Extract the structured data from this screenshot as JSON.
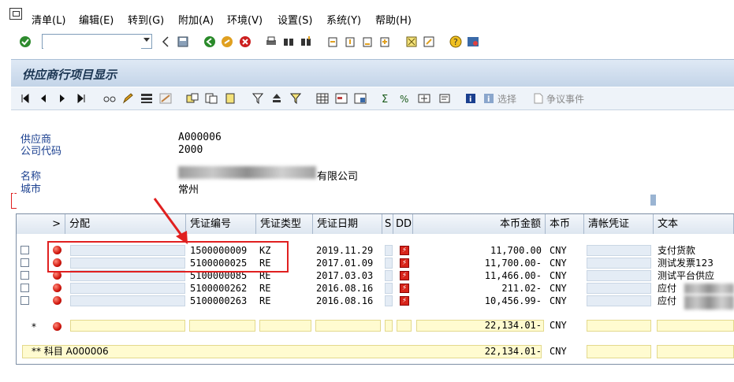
{
  "menu": [
    "清单(L)",
    "编辑(E)",
    "转到(G)",
    "附加(A)",
    "环境(V)",
    "设置(S)",
    "系统(Y)",
    "帮助(H)"
  ],
  "command_field": {
    "value": "",
    "placeholder": ""
  },
  "title": "供应商行项目显示",
  "app_toolbar": {
    "select_label": "选择",
    "dispute_label": "争议事件"
  },
  "header": {
    "vendor_label": "供应商",
    "vendor_value": "A000006",
    "company_label": "公司代码",
    "company_value": "2000",
    "name_label": "名称",
    "name_value": "有限公司",
    "city_label": "城市",
    "city_value": "常州"
  },
  "columns": [
    ">",
    "分配",
    "凭证编号",
    "凭证类型",
    "凭证日期",
    "S",
    "DD",
    "本币金额",
    "本币",
    "清帐凭证",
    "文本"
  ],
  "rows": [
    {
      "doc_no": "1500000009",
      "doc_type": "KZ",
      "date": "2019.11.29",
      "amount": "11,700.00",
      "currency": "CNY",
      "text": "支付货款"
    },
    {
      "doc_no": "5100000025",
      "doc_type": "RE",
      "date": "2017.01.09",
      "amount": "11,700.00-",
      "currency": "CNY",
      "text": "测试发票123"
    },
    {
      "doc_no": "5100000085",
      "doc_type": "RE",
      "date": "2017.03.03",
      "amount": "11,466.00-",
      "currency": "CNY",
      "text": "测试平台供应"
    },
    {
      "doc_no": "5100000262",
      "doc_type": "RE",
      "date": "2016.08.16",
      "amount": "211.02-",
      "currency": "CNY",
      "text": "应付"
    },
    {
      "doc_no": "5100000263",
      "doc_type": "RE",
      "date": "2016.08.16",
      "amount": "10,456.99-",
      "currency": "CNY",
      "text": "应付"
    }
  ],
  "subtotal": {
    "marker": "*",
    "amount": "22,134.01-",
    "currency": "CNY"
  },
  "total": {
    "label": "** 科目 A000006",
    "amount": "22,134.01-",
    "currency": "CNY"
  },
  "colors": {
    "annotation": "#e02020",
    "label_blue": "#1a3f8f",
    "total_yellow": "#fffbd0"
  }
}
